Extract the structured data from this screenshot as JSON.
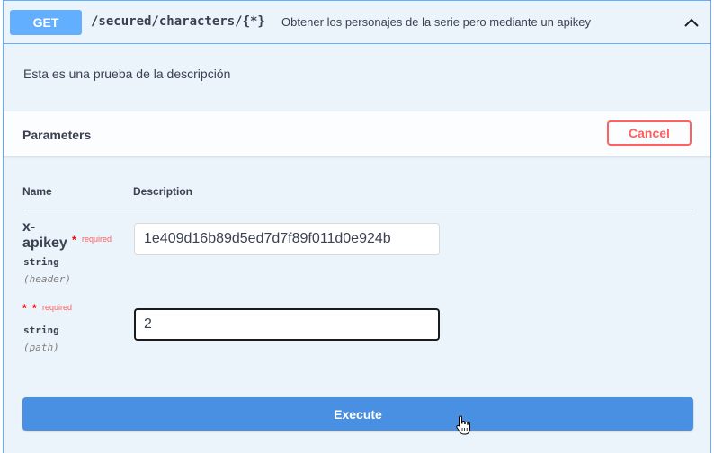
{
  "operation": {
    "method": "GET",
    "path": "/secured/characters/{*}",
    "summary": "Obtener los personajes de la serie pero mediante un apikey",
    "description": "Esta es una prueba de la descripción",
    "collapse_icon": "chevron-up-icon"
  },
  "parameters": {
    "title": "Parameters",
    "cancel_label": "Cancel",
    "columns": {
      "name": "Name",
      "description": "Description"
    },
    "items": [
      {
        "name_line1": "x-",
        "name_line2": "apikey",
        "required_mark": "*",
        "required_label": "required",
        "type": "string",
        "in": "(header)",
        "value": "1e409d16b89d5ed7d7f89f011d0e924b"
      },
      {
        "name_line1": "*",
        "required_mark": "*",
        "required_label": "required",
        "type": "string",
        "in": "(path)",
        "value": "2"
      }
    ]
  },
  "execute_label": "Execute",
  "colors": {
    "get_accent": "#61affe",
    "block_bg": "#ebf3fb",
    "cancel": "#ff6060",
    "execute": "#4990e2",
    "required": "#ff0000"
  }
}
